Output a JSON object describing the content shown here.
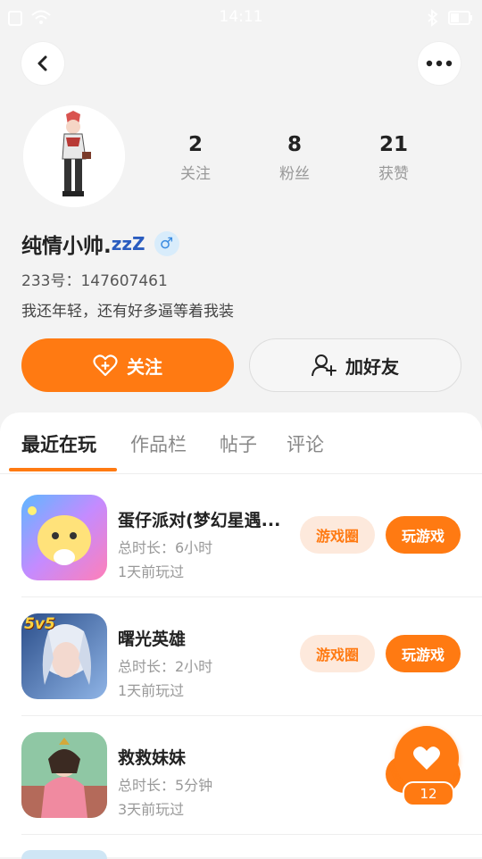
{
  "status": {
    "time": "14:11"
  },
  "profile": {
    "nickname": "纯情小帅.",
    "nickname_suffix": "zzZ",
    "gender_symbol": "♂",
    "id_text": "233号：147607461",
    "bio": "我还年轻，还有好多逼等着我装"
  },
  "stats": [
    {
      "value": "2",
      "label": "关注"
    },
    {
      "value": "8",
      "label": "粉丝"
    },
    {
      "value": "21",
      "label": "获赞"
    }
  ],
  "actions": {
    "follow_label": "关注",
    "add_friend_label": "加好友"
  },
  "tabs": [
    "最近在玩",
    "作品栏",
    "帖子",
    "评论"
  ],
  "games": [
    {
      "name": "蛋仔派对(梦幻星遇...",
      "duration": "总时长：6小时",
      "last_played": "1天前玩过",
      "circle_label": "游戏圈",
      "play_label": "玩游戏"
    },
    {
      "name": "曙光英雄",
      "duration": "总时长：2小时",
      "last_played": "1天前玩过",
      "circle_label": "游戏圈",
      "play_label": "玩游戏",
      "badge": "5v5"
    },
    {
      "name": "救救妹妹",
      "duration": "总时长：5分钟",
      "last_played": "3天前玩过"
    }
  ],
  "floating": {
    "like_count": "12"
  },
  "colors": {
    "accent": "#ff7a12",
    "accent_light": "#fde9dc",
    "background": "#f3f3f3"
  }
}
